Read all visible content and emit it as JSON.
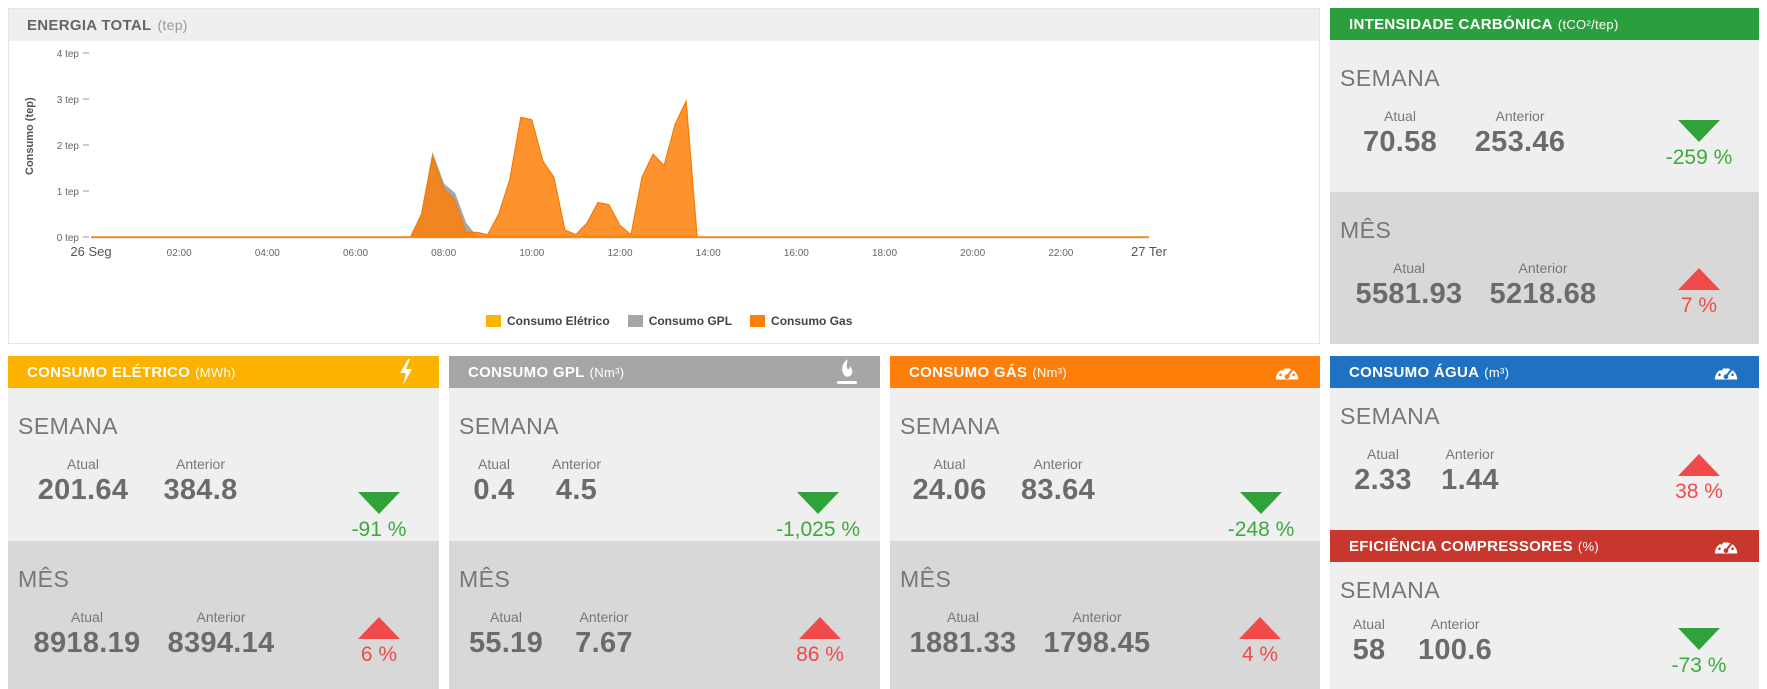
{
  "colors": {
    "eletrico": "#fbb300",
    "gpl": "#a6a6a6",
    "gas": "#fd7f0a",
    "agua": "#1f72c2",
    "carbonica": "#2b9e3e",
    "compressores": "#c8372d",
    "trend_down": "#2fa33a",
    "trend_up": "#f04a4a"
  },
  "energia": {
    "title": "ENERGIA TOTAL",
    "unit": "(tep)"
  },
  "chart_data": {
    "type": "area",
    "ylabel": "Consumo (tep)",
    "ylim": [
      0,
      4
    ],
    "yticks": [
      "0 tep",
      "1 tep",
      "2 tep",
      "3 tep",
      "4 tep"
    ],
    "xlim": [
      0,
      24
    ],
    "xticks": [
      {
        "h": 0,
        "label": "26 Seg"
      },
      {
        "h": 2,
        "label": "02:00"
      },
      {
        "h": 4,
        "label": "04:00"
      },
      {
        "h": 6,
        "label": "06:00"
      },
      {
        "h": 8,
        "label": "08:00"
      },
      {
        "h": 10,
        "label": "10:00"
      },
      {
        "h": 12,
        "label": "12:00"
      },
      {
        "h": 14,
        "label": "14:00"
      },
      {
        "h": 16,
        "label": "16:00"
      },
      {
        "h": 18,
        "label": "18:00"
      },
      {
        "h": 20,
        "label": "20:00"
      },
      {
        "h": 22,
        "label": "22:00"
      },
      {
        "h": 24,
        "label": "27 Ter"
      }
    ],
    "series": [
      {
        "name": "Consumo Elétrico",
        "color": "#fbb300",
        "x": [
          0,
          24
        ],
        "y": [
          0,
          0
        ]
      },
      {
        "name": "Consumo GPL",
        "color": "#a6a6a6",
        "x": [
          0,
          7.25,
          7.5,
          7.75,
          8.0,
          8.25,
          8.5,
          8.75,
          24
        ],
        "y": [
          0,
          0,
          0.5,
          1.8,
          1.15,
          0.95,
          0.3,
          0,
          0
        ]
      },
      {
        "name": "Consumo Gas",
        "color": "#fd7f0a",
        "x": [
          0,
          7.25,
          7.5,
          7.75,
          8.0,
          8.25,
          8.5,
          8.75,
          9.0,
          9.25,
          9.5,
          9.75,
          10.0,
          10.25,
          10.5,
          10.75,
          11.0,
          11.25,
          11.5,
          11.75,
          12.0,
          12.25,
          12.5,
          12.75,
          13.0,
          13.25,
          13.5,
          13.75,
          24
        ],
        "y": [
          0,
          0,
          0.5,
          1.75,
          1.05,
          0.8,
          0.1,
          0.1,
          0.05,
          0.5,
          1.25,
          2.6,
          2.55,
          1.65,
          1.3,
          0.15,
          0.05,
          0.3,
          0.75,
          0.7,
          0.25,
          0.05,
          1.3,
          1.8,
          1.55,
          2.45,
          2.95,
          0,
          0
        ]
      }
    ]
  },
  "cards": {
    "eletrico": {
      "title": "CONSUMO ELÉTRICO",
      "unit": "(MWh)",
      "icon": "lightning-icon",
      "semana": {
        "label": "SEMANA",
        "atual_label": "Atual",
        "anterior_label": "Anterior",
        "atual": "201.64",
        "anterior": "384.8",
        "pct": "-91 %",
        "dir": "down"
      },
      "mes": {
        "label": "MÊS",
        "atual_label": "Atual",
        "anterior_label": "Anterior",
        "atual": "8918.19",
        "anterior": "8394.14",
        "pct": "6 %",
        "dir": "up"
      }
    },
    "gpl": {
      "title": "CONSUMO GPL",
      "unit": "(Nm³)",
      "icon": "flame-icon",
      "semana": {
        "label": "SEMANA",
        "atual_label": "Atual",
        "anterior_label": "Anterior",
        "atual": "0.4",
        "anterior": "4.5",
        "pct": "-1,025 %",
        "dir": "down"
      },
      "mes": {
        "label": "MÊS",
        "atual_label": "Atual",
        "anterior_label": "Anterior",
        "atual": "55.19",
        "anterior": "7.67",
        "pct": "86 %",
        "dir": "up"
      }
    },
    "gas": {
      "title": "CONSUMO GÁS",
      "unit": "(Nm³)",
      "icon": "gauge-icon",
      "semana": {
        "label": "SEMANA",
        "atual_label": "Atual",
        "anterior_label": "Anterior",
        "atual": "24.06",
        "anterior": "83.64",
        "pct": "-248 %",
        "dir": "down"
      },
      "mes": {
        "label": "MÊS",
        "atual_label": "Atual",
        "anterior_label": "Anterior",
        "atual": "1881.33",
        "anterior": "1798.45",
        "pct": "4 %",
        "dir": "up"
      }
    },
    "carbonica": {
      "title": "INTENSIDADE CARBÓNICA",
      "unit": "(tCO²/tep)",
      "semana": {
        "label": "SEMANA",
        "atual_label": "Atual",
        "anterior_label": "Anterior",
        "atual": "70.58",
        "anterior": "253.46",
        "pct": "-259 %",
        "dir": "down"
      },
      "mes": {
        "label": "MÊS",
        "atual_label": "Atual",
        "anterior_label": "Anterior",
        "atual": "5581.93",
        "anterior": "5218.68",
        "pct": "7 %",
        "dir": "up"
      }
    },
    "agua": {
      "title": "CONSUMO ÁGUA",
      "unit": "(m³)",
      "icon": "gauge-icon",
      "semana": {
        "label": "SEMANA",
        "atual_label": "Atual",
        "anterior_label": "Anterior",
        "atual": "2.33",
        "anterior": "1.44",
        "pct": "38 %",
        "dir": "up"
      }
    },
    "compressores": {
      "title": "EFICIÊNCIA COMPRESSORES",
      "unit": "(%)",
      "icon": "gauge-icon",
      "semana": {
        "label": "SEMANA",
        "atual_label": "Atual",
        "anterior_label": "Anterior",
        "atual": "58",
        "anterior": "100.6",
        "pct": "-73 %",
        "dir": "down"
      }
    }
  }
}
